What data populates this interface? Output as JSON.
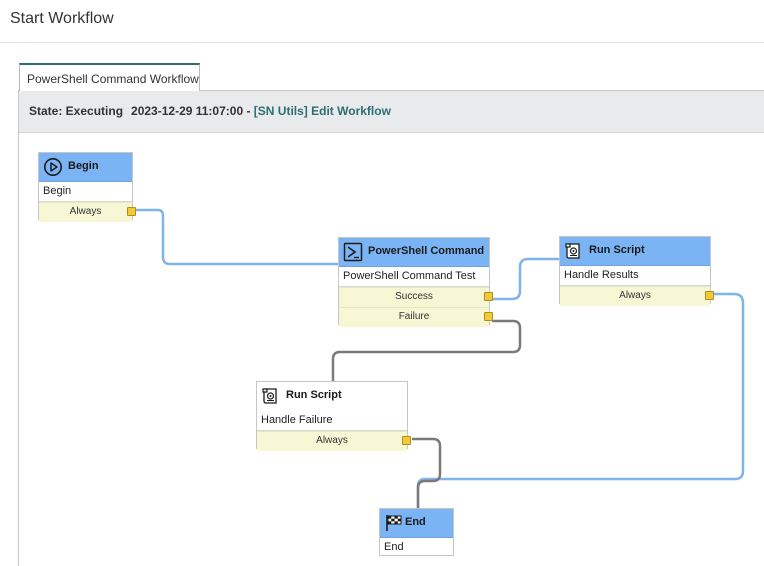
{
  "page": {
    "title": "Start Workflow"
  },
  "tab": {
    "label": "PowerShell Command Workflow"
  },
  "status": {
    "state": "State: Executing",
    "timestamp": "2023-12-29 11:07:00 -",
    "link": "[SN Utils] Edit Workflow"
  },
  "nodes": {
    "begin": {
      "title": "Begin",
      "description": "Begin",
      "conditions": [
        "Always"
      ],
      "icon": "play-circle-icon"
    },
    "powershell": {
      "title": "PowerShell Command",
      "description": "PowerShell Command Test",
      "conditions": [
        "Success",
        "Failure"
      ],
      "icon": "terminal-prompt-icon"
    },
    "run_script_results": {
      "title": "Run Script",
      "description": "Handle Results",
      "conditions": [
        "Always"
      ],
      "icon": "script-scroll-icon"
    },
    "run_script_failure": {
      "title": "Run Script",
      "description": "Handle Failure",
      "conditions": [
        "Always"
      ],
      "icon": "script-scroll-icon"
    },
    "end": {
      "title": "End",
      "description": "End",
      "icon": "checkered-flag-icon"
    }
  },
  "colors": {
    "node_header": "#7bb4f4",
    "condition_bg": "#f7f7d6",
    "port": "#f2c93a",
    "connector_taken": "#7fb5e8",
    "connector_not_taken": "#7a7a7a",
    "link": "#2d6e75"
  }
}
